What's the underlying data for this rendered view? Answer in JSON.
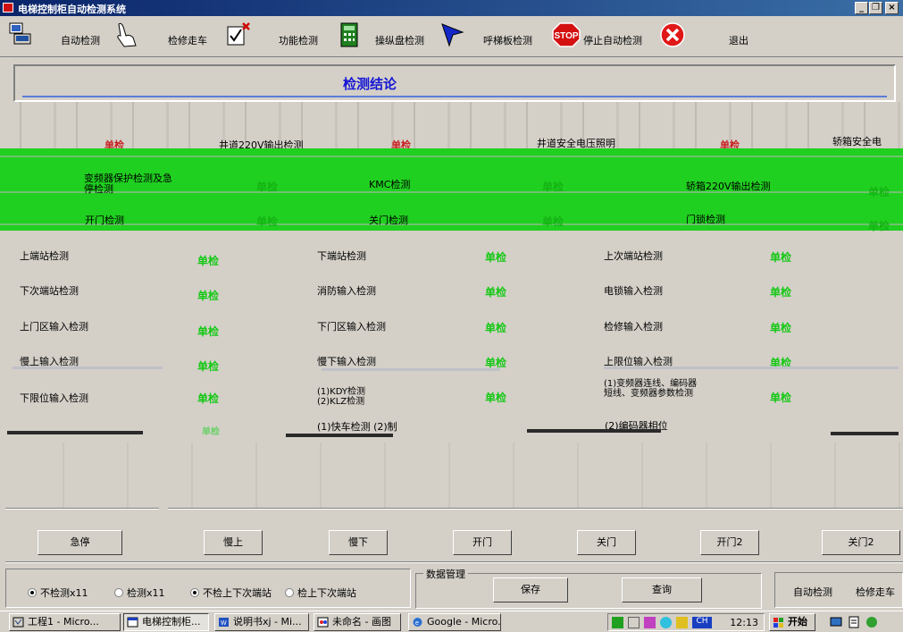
{
  "window": {
    "title": "电梯控制柜自动检测系统",
    "min": "_",
    "max": "❐",
    "close": "×"
  },
  "toolbar": {
    "auto_test": "自动检测",
    "maint_run": "检修走车",
    "func_test": "功能检测",
    "console_test": "操纵盘检测",
    "call_test": "呼梯板检测",
    "stop_badge": "STOP",
    "stop_auto": "停止自动检测",
    "exit": "退出"
  },
  "conclusion": {
    "title": "检测结论"
  },
  "glitch_row": {
    "cells": [
      "单检",
      "井道220V输出检测",
      "单检",
      "井道安全电压照明",
      "单检",
      "轿箱安全电"
    ]
  },
  "green_rows": [
    [
      "变频器保护检测及急停检测",
      "单检",
      "KMC检测",
      "单检",
      "轿箱220V输出检测",
      "单检"
    ],
    [
      "开门检测",
      "单检",
      "关门检测",
      "单检",
      "门锁检测",
      "单检"
    ]
  ],
  "rows": [
    [
      "上端站检测",
      "单检",
      "下端站检测",
      "单检",
      "上次端站检测",
      "单检"
    ],
    [
      "下次端站检测",
      "单检",
      "消防输入检测",
      "单检",
      "电锁输入检测",
      "单检"
    ],
    [
      "上门区输入检测",
      "单检",
      "下门区输入检测",
      "单检",
      "检修输入检测",
      "单检"
    ],
    [
      "慢上输入检测",
      "单检",
      "慢下输入检测",
      "单检",
      "上限位输入检测",
      "单检"
    ],
    [
      "下限位输入检测",
      "单检",
      "(1)KDY检测\n(2)KLZ检测",
      "单检",
      "(1)变频器连线、编码器短线、变频器参数检测",
      "单检"
    ]
  ],
  "partial_row": [
    "单检",
    "(1)快车检测 (2)制",
    "(2)编码器相位"
  ],
  "control_buttons": [
    "急停",
    "慢上",
    "慢下",
    "开门",
    "关门",
    "开门2",
    "关门2"
  ],
  "options": {
    "radios": [
      {
        "label": "不检测x11",
        "checked": true
      },
      {
        "label": "检测x11",
        "checked": false
      },
      {
        "label": "不检上下次端站",
        "checked": true
      },
      {
        "label": "检上下次端站",
        "checked": false
      }
    ]
  },
  "data_mgmt": {
    "legend": "数据管理",
    "save": "保存",
    "query": "查询"
  },
  "mode_panel": {
    "auto": "自动检测",
    "maint": "检修走车"
  },
  "taskbar": {
    "tasks": [
      "工程1 - Micro...",
      "电梯控制柜...",
      "说明书xj - Mi...",
      "未命名 - 画图",
      "Google - Micro..."
    ],
    "clock": "12:13",
    "ime": "CH",
    "start": "开始"
  },
  "colors": {
    "accent_green": "#20d020",
    "title_blue": "#1414d4",
    "value_green": "#14c814"
  }
}
